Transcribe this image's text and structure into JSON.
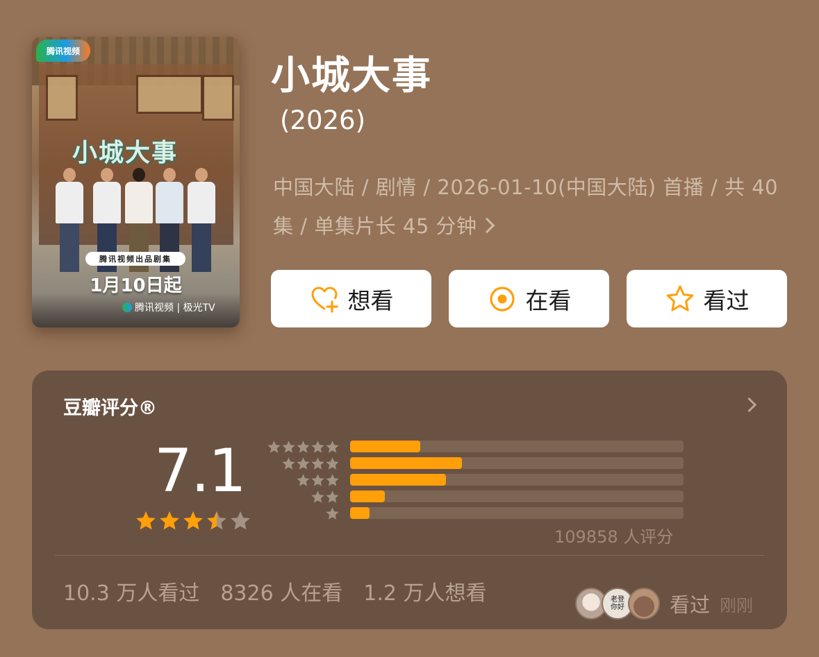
{
  "poster": {
    "platform_badge": "腾讯视频",
    "title_art": "小城大事",
    "badge_text": "腾讯视频出品剧集",
    "date_text": "1月10日起",
    "platforms_text": "腾讯视频 | 极光TV"
  },
  "show": {
    "title": "小城大事",
    "year": "(2026)",
    "meta": "中国大陆 / 剧情 / 2026-01-10(中国大陆) 首播 / 共 40 集 / 单集片长 45 分钟"
  },
  "actions": {
    "want": "想看",
    "watching": "在看",
    "watched": "看过"
  },
  "colors": {
    "background": "#957358",
    "card": "#6a5242",
    "accent": "#ff9f0a",
    "star_empty": "#a29385"
  },
  "rating": {
    "title": "豆瓣评分®",
    "score": "7.1",
    "stars": 3.5,
    "distribution": [
      {
        "stars": 5,
        "fraction": 0.21
      },
      {
        "stars": 4,
        "fraction": 0.335
      },
      {
        "stars": 3,
        "fraction": 0.288
      },
      {
        "stars": 2,
        "fraction": 0.105
      },
      {
        "stars": 1,
        "fraction": 0.058
      }
    ],
    "raters_text": "109858 人评分",
    "watched_count": "10.3 万人看过",
    "watching_count": "8326 人在看",
    "want_count": "1.2 万人想看",
    "friend_status": "看过",
    "friend_time": "刚刚",
    "avatar_text": "老登\n你好"
  }
}
